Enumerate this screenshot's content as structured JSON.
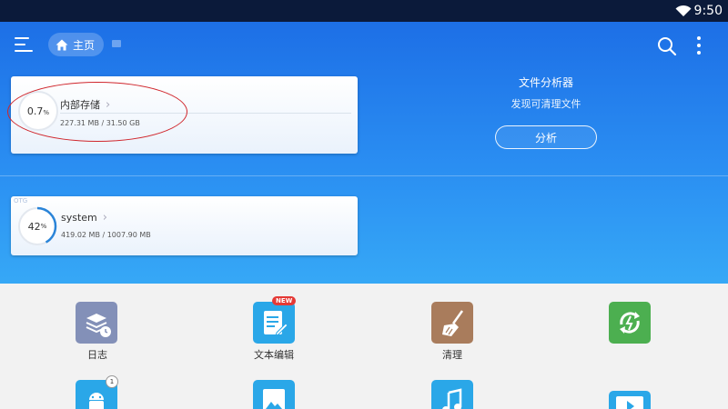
{
  "status_bar": {
    "time": "9:50",
    "icons": [
      "wifi-icon"
    ]
  },
  "toolbar": {
    "menu_icon": "hamburger-menu-icon",
    "breadcrumb_icon": "home-icon",
    "breadcrumb_label": "主页",
    "search_icon": "search-icon",
    "more_icon": "more-vertical-icon"
  },
  "storage": [
    {
      "name": "内部存储",
      "percent_text": "0.7",
      "percent_unit": "%",
      "usage": "227.31 MB / 31.50 GB",
      "used_fraction": 0.007
    },
    {
      "tag": "OTG",
      "name": "system",
      "percent_text": "42",
      "percent_unit": "%",
      "usage": "419.02 MB / 1007.90 MB",
      "used_fraction": 0.42
    }
  ],
  "analyzer": {
    "title": "文件分析器",
    "subtitle": "发现可清理文件",
    "button_label": "分析"
  },
  "apps": [
    {
      "label": "日志",
      "icon": "log-icon",
      "color": "#8390b8"
    },
    {
      "label": "文本编辑",
      "icon": "text-editor-icon",
      "color": "#2aa7e8",
      "badge": "NEW"
    },
    {
      "label": "清理",
      "icon": "cleaner-broom-icon",
      "color": "#a97c5c"
    },
    {
      "label": "",
      "icon": "recycle-icon",
      "color": "#4caf50"
    },
    {
      "label": "",
      "icon": "android-icon",
      "color": "#2aa7e8",
      "badge": "1"
    },
    {
      "label": "",
      "icon": "image-icon",
      "color": "#2aa7e8"
    },
    {
      "label": "",
      "icon": "music-icon",
      "color": "#2aa7e8"
    },
    {
      "label": "",
      "icon": "video-icon",
      "color": "#2aa7e8"
    }
  ]
}
